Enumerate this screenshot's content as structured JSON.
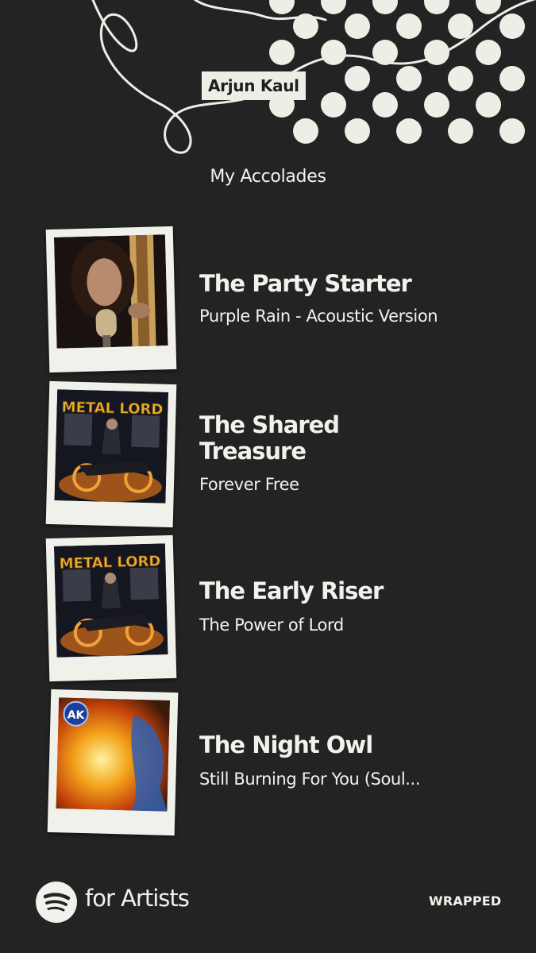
{
  "header": {
    "artist_name": "Arjun Kaul",
    "section_title": "My Accolades"
  },
  "accolades": [
    {
      "title": "The Party Starter",
      "song": "Purple Rain - Acoustic Version",
      "cover_icon": "artist-portrait-icon"
    },
    {
      "title": "The Shared Treasure",
      "song": "Forever Free",
      "cover_icon": "metal-lord-cover-icon"
    },
    {
      "title": "The Early Riser",
      "song": "The Power of Lord",
      "cover_icon": "metal-lord-cover-icon"
    },
    {
      "title": "The Night Owl",
      "song": "Still Burning For You (Soul...",
      "cover_icon": "fire-cover-icon"
    }
  ],
  "cover_art": {
    "metal_lord_text": "METAL LORD",
    "ak_logo_text": "AK"
  },
  "footer": {
    "brand": "for Artists",
    "tag": "WRAPPED"
  },
  "colors": {
    "background": "#232323",
    "accent": "#eeeee6",
    "text": "#f2f2ec"
  }
}
